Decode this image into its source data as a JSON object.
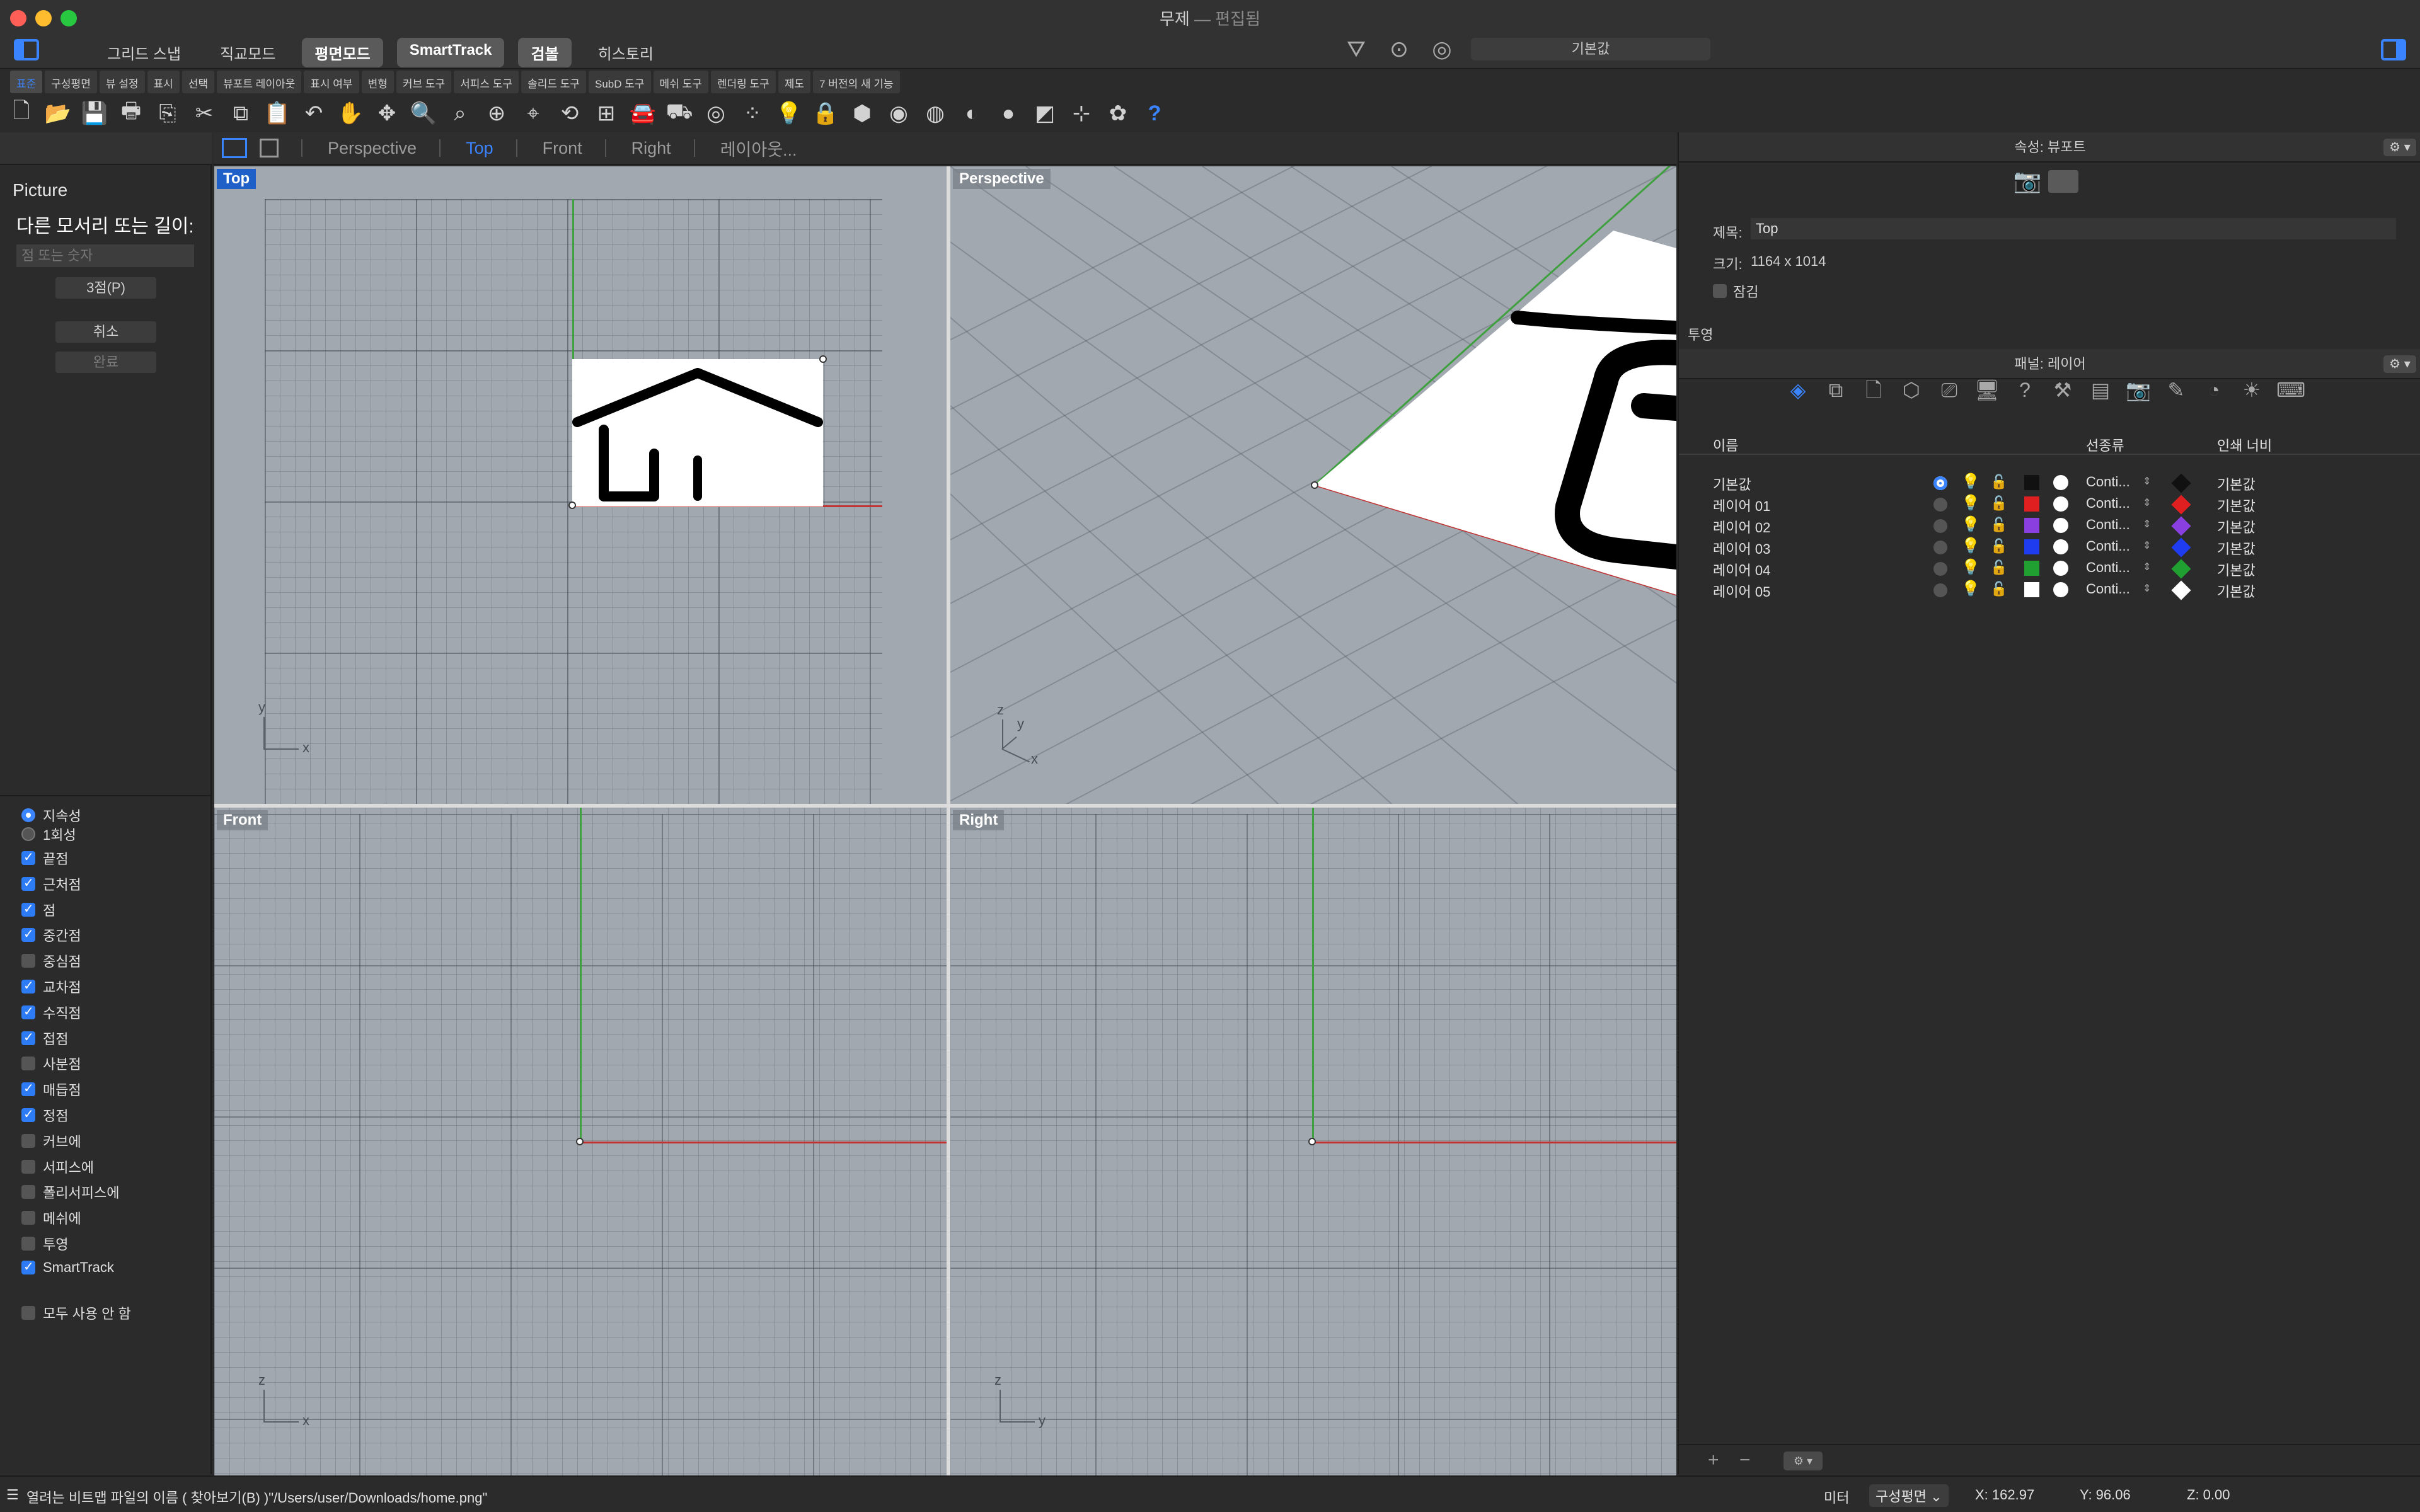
{
  "window": {
    "title": "무제",
    "subtitle": "편집됨"
  },
  "modes": [
    {
      "label": "그리드 스냅",
      "active": false
    },
    {
      "label": "직교모드",
      "active": false
    },
    {
      "label": "평면모드",
      "active": true
    },
    {
      "label": "SmartTrack",
      "active": true
    },
    {
      "label": "검볼",
      "active": true
    },
    {
      "label": "히스토리",
      "active": false
    }
  ],
  "title_icons": [
    "filter-icon",
    "record-icon",
    "target-icon"
  ],
  "layer_combo": "기본값",
  "tabs": [
    "표준",
    "구성평면",
    "뷰 설정",
    "표시",
    "선택",
    "뷰포트 레이아웃",
    "표시 여부",
    "변형",
    "커브 도구",
    "서피스 도구",
    "솔리드 도구",
    "SubD 도구",
    "메쉬 도구",
    "렌더링 도구",
    "제도",
    "7 버전의 새 기능"
  ],
  "active_tab": 0,
  "toolbar_icons": [
    {
      "name": "new-file-icon",
      "glyph": "🗋"
    },
    {
      "name": "open-folder-icon",
      "glyph": "📂"
    },
    {
      "name": "save-icon",
      "glyph": "💾"
    },
    {
      "name": "print-icon",
      "glyph": "🖶"
    },
    {
      "name": "import-icon",
      "glyph": "⎘"
    },
    {
      "name": "cut-icon",
      "glyph": "✂"
    },
    {
      "name": "copy-icon",
      "glyph": "⧉"
    },
    {
      "name": "paste-icon",
      "glyph": "📋"
    },
    {
      "name": "undo-icon",
      "glyph": "↶"
    },
    {
      "name": "pan-hand-icon",
      "glyph": "✋"
    },
    {
      "name": "rotate-view-icon",
      "glyph": "✥"
    },
    {
      "name": "zoom-icon",
      "glyph": "🔍"
    },
    {
      "name": "zoom-window-icon",
      "glyph": "⌕"
    },
    {
      "name": "zoom-extents-icon",
      "glyph": "⊕"
    },
    {
      "name": "zoom-selected-icon",
      "glyph": "⌖"
    },
    {
      "name": "undo-view-icon",
      "glyph": "⟲"
    },
    {
      "name": "four-viewports-icon",
      "glyph": "⊞"
    },
    {
      "name": "car-icon",
      "glyph": "🚘"
    },
    {
      "name": "display-mode-icon",
      "glyph": "⛟"
    },
    {
      "name": "osnap-icon",
      "glyph": "◎"
    },
    {
      "name": "select-points-icon",
      "glyph": "⁘"
    },
    {
      "name": "light-bulb-icon",
      "glyph": "💡"
    },
    {
      "name": "lock-icon",
      "glyph": "🔒"
    },
    {
      "name": "material-icon",
      "glyph": "⬢"
    },
    {
      "name": "color-wheel-icon",
      "glyph": "◉"
    },
    {
      "name": "sphere-wire-icon",
      "glyph": "◍"
    },
    {
      "name": "render-sphere-icon",
      "glyph": "◐"
    },
    {
      "name": "blue-sphere-icon",
      "glyph": "●"
    },
    {
      "name": "texture-icon",
      "glyph": "◩"
    },
    {
      "name": "gumball-icon",
      "glyph": "⊹"
    },
    {
      "name": "grasshopper-icon",
      "glyph": "✿"
    },
    {
      "name": "help-icon",
      "glyph": "?"
    }
  ],
  "command": {
    "name": "Picture",
    "prompt": "다른 모서리 또는 길이:",
    "placeholder": "점 또는 숫자",
    "btn_3pt": "3점(P)",
    "btn_cancel": "취소",
    "btn_done": "완료"
  },
  "osnap": {
    "persistent": "지속성",
    "oneshot": "1회성",
    "items": [
      {
        "label": "끝점",
        "checked": true
      },
      {
        "label": "근처점",
        "checked": true
      },
      {
        "label": "점",
        "checked": true
      },
      {
        "label": "중간점",
        "checked": true
      },
      {
        "label": "중심점",
        "checked": false
      },
      {
        "label": "교차점",
        "checked": true
      },
      {
        "label": "수직점",
        "checked": true
      },
      {
        "label": "접점",
        "checked": true
      },
      {
        "label": "사분점",
        "checked": false
      },
      {
        "label": "매듭점",
        "checked": true
      },
      {
        "label": "정점",
        "checked": true
      },
      {
        "label": "커브에",
        "checked": false
      },
      {
        "label": "서피스에",
        "checked": false
      },
      {
        "label": "폴리서피스에",
        "checked": false
      },
      {
        "label": "메쉬에",
        "checked": false
      },
      {
        "label": "투영",
        "checked": false
      },
      {
        "label": "SmartTrack",
        "checked": true
      }
    ],
    "disable_all": "모두 사용 안 함"
  },
  "viewport_tabs": [
    "Perspective",
    "Top",
    "Front",
    "Right",
    "레이아웃..."
  ],
  "viewports": {
    "top": "Top",
    "perspective": "Perspective",
    "front": "Front",
    "right": "Right"
  },
  "axes": {
    "x": "x",
    "y": "y",
    "z": "z"
  },
  "properties": {
    "header": "속성: 뷰포트",
    "title_label": "제목:",
    "title_value": "Top",
    "size_label": "크기:",
    "size_value": "1164 x 1014",
    "lock_label": "잠김",
    "projection_label": "투영"
  },
  "layers_panel": {
    "header": "패널: 레이어",
    "gear": "⚙︎ ▾",
    "icons": [
      "layers-icon",
      "objects-icon",
      "page-icon",
      "block-icon",
      "display-icon",
      "viewport-icon",
      "help-icon",
      "tools-icon",
      "document-icon",
      "camera-icon",
      "brush-icon",
      "environment-icon",
      "light-icon",
      "keyboard-icon"
    ],
    "columns": {
      "name": "이름",
      "linetype": "선종류",
      "printwidth": "인쇄 너비"
    },
    "rows": [
      {
        "name": "기본값",
        "current": true,
        "color": "#111111",
        "linetype": "Conti...",
        "pw": "기본값"
      },
      {
        "name": "레이어 01",
        "current": false,
        "color": "#e02020",
        "linetype": "Conti...",
        "pw": "기본값"
      },
      {
        "name": "레이어 02",
        "current": false,
        "color": "#8a40e0",
        "linetype": "Conti...",
        "pw": "기본값"
      },
      {
        "name": "레이어 03",
        "current": false,
        "color": "#1f3cf0",
        "linetype": "Conti...",
        "pw": "기본값"
      },
      {
        "name": "레이어 04",
        "current": false,
        "color": "#20a030",
        "linetype": "Conti...",
        "pw": "기본값"
      },
      {
        "name": "레이어 05",
        "current": false,
        "color": "#ffffff",
        "linetype": "Conti...",
        "pw": "기본값"
      }
    ],
    "add": "+",
    "remove": "−"
  },
  "status": {
    "message": "열려는 비트맵 파일의 이름 ( 찾아보기(B) )\"/Users/user/Downloads/home.png\"",
    "units": "미터",
    "cplane": "구성평면",
    "x": "X: 162.97",
    "y": "Y: 96.06",
    "z": "Z: 0.00"
  },
  "colors": {
    "accent": "#3a84ff",
    "viewport": "#a2a8b0",
    "panel": "#2b2b2b"
  }
}
